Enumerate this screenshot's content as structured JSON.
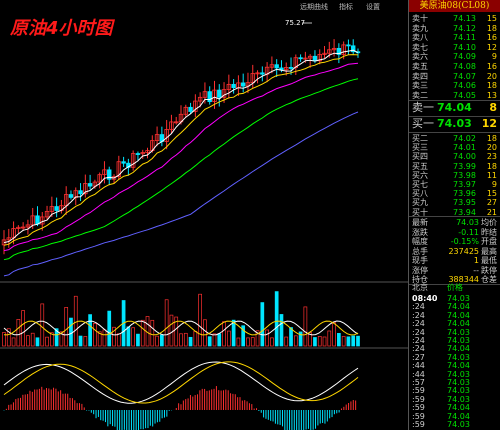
{
  "chart_title": "原油4小时图",
  "top_links": [
    "远期曲线",
    "指标",
    "设置"
  ],
  "peak_label": "75.27",
  "instrument": "美原油08(CL08)",
  "asks": [
    {
      "label": "卖十",
      "price": "74.13",
      "vol": "15"
    },
    {
      "label": "卖九",
      "price": "74.12",
      "vol": "18"
    },
    {
      "label": "卖八",
      "price": "74.11",
      "vol": "16"
    },
    {
      "label": "卖七",
      "price": "74.10",
      "vol": "12"
    },
    {
      "label": "卖六",
      "price": "74.09",
      "vol": "9"
    },
    {
      "label": "卖五",
      "price": "74.08",
      "vol": "16"
    },
    {
      "label": "卖四",
      "price": "74.07",
      "vol": "20"
    },
    {
      "label": "卖三",
      "price": "74.06",
      "vol": "18"
    },
    {
      "label": "卖二",
      "price": "74.05",
      "vol": "13"
    }
  ],
  "ask1": {
    "label": "卖一",
    "price": "74.04",
    "vol": "8"
  },
  "bid1": {
    "label": "买一",
    "price": "74.03",
    "vol": "12"
  },
  "bids": [
    {
      "label": "买二",
      "price": "74.02",
      "vol": "18"
    },
    {
      "label": "买三",
      "price": "74.01",
      "vol": "20"
    },
    {
      "label": "买四",
      "price": "74.00",
      "vol": "23"
    },
    {
      "label": "买五",
      "price": "73.99",
      "vol": "18"
    },
    {
      "label": "买六",
      "price": "73.98",
      "vol": "11"
    },
    {
      "label": "买七",
      "price": "73.97",
      "vol": "9"
    },
    {
      "label": "买八",
      "price": "73.96",
      "vol": "15"
    },
    {
      "label": "买九",
      "price": "73.95",
      "vol": "27"
    },
    {
      "label": "买十",
      "price": "73.94",
      "vol": "21"
    }
  ],
  "stats": [
    {
      "label": "最新",
      "value": "74.03",
      "color": "#00e000",
      "label2": "均价"
    },
    {
      "label": "涨跌",
      "value": "-0.11",
      "color": "#00e000",
      "label2": "昨结"
    },
    {
      "label": "幅度",
      "value": "-0.15%",
      "color": "#00e000",
      "label2": "开盘"
    },
    {
      "label": "总手",
      "value": "237425",
      "color": "#ffd700",
      "label2": "最高"
    },
    {
      "label": "现手",
      "value": "1",
      "color": "#ffd700",
      "label2": "最低"
    },
    {
      "label": "涨停",
      "value": "--",
      "color": "#ccc",
      "label2": "跌停"
    },
    {
      "label": "持仓",
      "value": "388344",
      "color": "#ffd700",
      "label2": "仓差"
    }
  ],
  "ticks_header": {
    "location": "北京",
    "price": "价格"
  },
  "ticks": [
    {
      "time": "08:40",
      "price": "74.03",
      "vol": ""
    },
    {
      "time": ":24",
      "price": "74.04",
      "vol": ""
    },
    {
      "time": ":24",
      "price": "74.04",
      "vol": ""
    },
    {
      "time": ":24",
      "price": "74.04",
      "vol": ""
    },
    {
      "time": ":24",
      "price": "74.03",
      "vol": ""
    },
    {
      "time": ":24",
      "price": "74.03",
      "vol": ""
    },
    {
      "time": ":24",
      "price": "74.04",
      "vol": ""
    },
    {
      "time": ":27",
      "price": "74.03",
      "vol": ""
    },
    {
      "time": ":44",
      "price": "74.04",
      "vol": ""
    },
    {
      "time": ":44",
      "price": "74.03",
      "vol": ""
    },
    {
      "time": ":57",
      "price": "74.03",
      "vol": ""
    },
    {
      "time": ":59",
      "price": "74.03",
      "vol": ""
    },
    {
      "time": ":59",
      "price": "74.03",
      "vol": ""
    },
    {
      "time": ":59",
      "price": "74.04",
      "vol": ""
    },
    {
      "time": ":59",
      "price": "74.04",
      "vol": ""
    },
    {
      "time": ":59",
      "price": "74.03",
      "vol": ""
    }
  ]
}
